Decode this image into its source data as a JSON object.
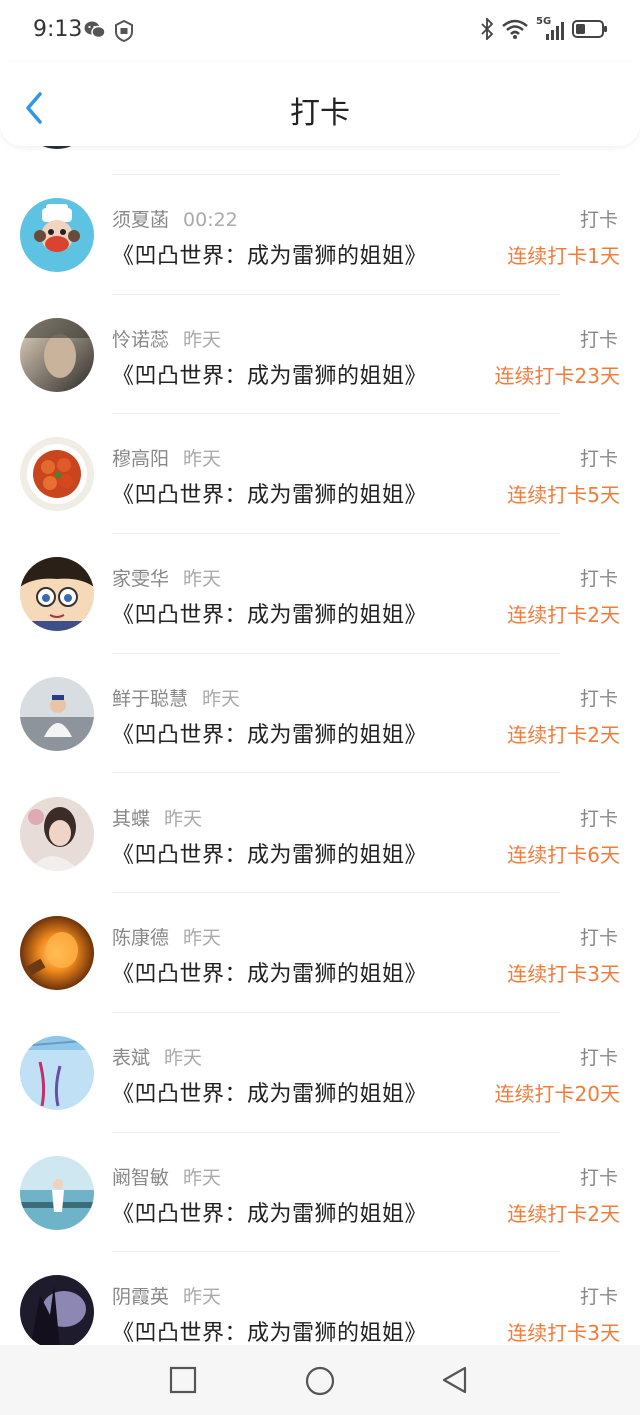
{
  "status_bar": {
    "time": "9:13",
    "left_icons": [
      "wechat-icon",
      "shield-app-icon"
    ],
    "right_icons": [
      "bluetooth-icon",
      "wifi-icon",
      "signal-5g-icon",
      "battery-icon"
    ],
    "network_label": "5G"
  },
  "header": {
    "title": "打卡"
  },
  "colors": {
    "accent_blue": "#2f95e6",
    "streak_orange": "#f27b3a"
  },
  "items": [
    {
      "name": "须夏菡",
      "time": "00:22",
      "book": "《凹凸世界：成为雷狮的姐姐》",
      "action": "打卡",
      "streak": "连续打卡1天",
      "avatar": "cartoon-monkey-avatar"
    },
    {
      "name": "怜诺蕊",
      "time": "昨天",
      "book": "《凹凸世界：成为雷狮的姐姐》",
      "action": "打卡",
      "streak": "连续打卡23天",
      "avatar": "photo-avatar"
    },
    {
      "name": "穆高阳",
      "time": "昨天",
      "book": "《凹凸世界：成为雷狮的姐姐》",
      "action": "打卡",
      "streak": "连续打卡5天",
      "avatar": "food-avatar"
    },
    {
      "name": "家雯华",
      "time": "昨天",
      "book": "《凹凸世界：成为雷狮的姐姐》",
      "action": "打卡",
      "streak": "连续打卡2天",
      "avatar": "anime-avatar"
    },
    {
      "name": "鲜于聪慧",
      "time": "昨天",
      "book": "《凹凸世界：成为雷狮的姐姐》",
      "action": "打卡",
      "streak": "连续打卡2天",
      "avatar": "person-avatar"
    },
    {
      "name": "其蝶",
      "time": "昨天",
      "book": "《凹凸世界：成为雷狮的姐姐》",
      "action": "打卡",
      "streak": "连续打卡6天",
      "avatar": "girl-avatar"
    },
    {
      "name": "陈康德",
      "time": "昨天",
      "book": "《凹凸世界：成为雷狮的姐姐》",
      "action": "打卡",
      "streak": "连续打卡3天",
      "avatar": "lightbulb-avatar"
    },
    {
      "name": "表斌",
      "time": "昨天",
      "book": "《凹凸世界：成为雷狮的姐姐》",
      "action": "打卡",
      "streak": "连续打卡20天",
      "avatar": "sky-avatar"
    },
    {
      "name": "阚智敏",
      "time": "昨天",
      "book": "《凹凸世界：成为雷狮的姐姐》",
      "action": "打卡",
      "streak": "连续打卡2天",
      "avatar": "sea-avatar"
    },
    {
      "name": "阴霞英",
      "time": "昨天",
      "book": "《凹凸世界：成为雷狮的姐姐》",
      "action": "打卡",
      "streak": "连续打卡3天",
      "avatar": "dark-art-avatar"
    }
  ],
  "nav_bar": {
    "buttons": [
      "recents-square-icon",
      "home-circle-icon",
      "back-triangle-icon"
    ]
  }
}
